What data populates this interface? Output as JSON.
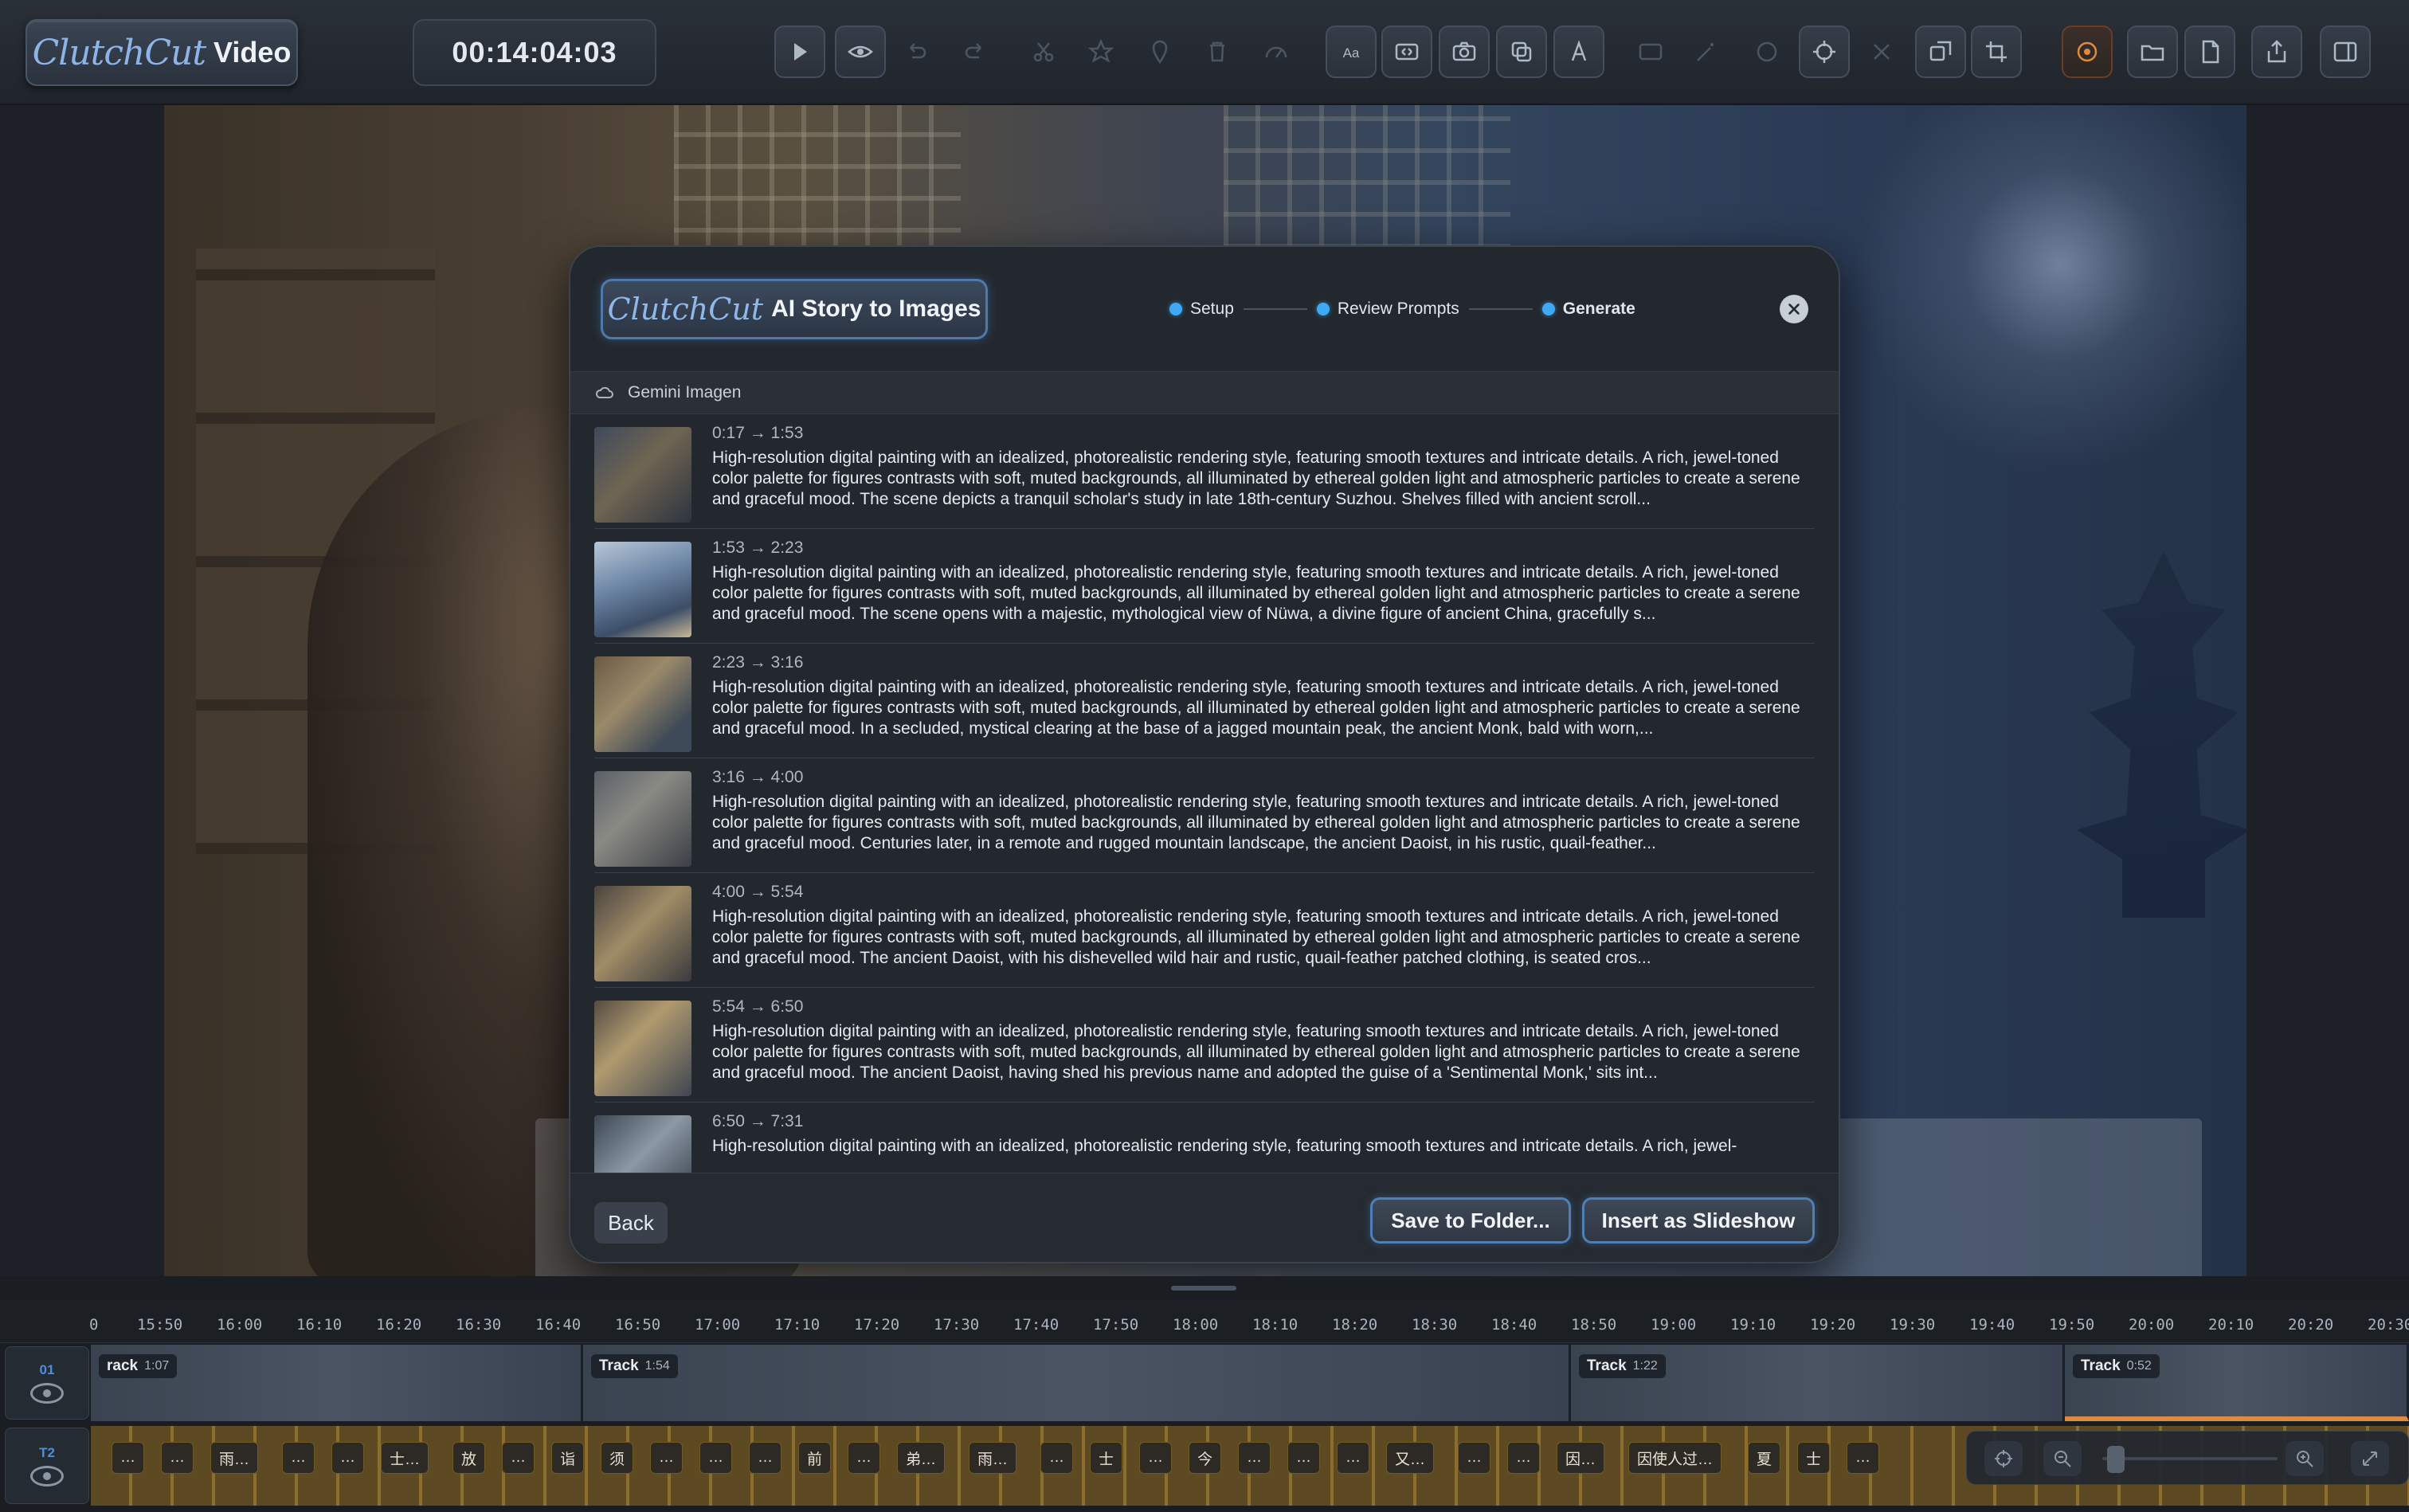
{
  "app": {
    "brand_script": "ClutchCut",
    "brand_word": "Video",
    "timecode": "00:14:04:03"
  },
  "toolbar": {
    "buttons": [
      {
        "name": "play-icon",
        "active": true
      },
      {
        "name": "eye-icon",
        "active": true
      },
      {
        "name": "undo-icon",
        "active": false
      },
      {
        "name": "redo-icon",
        "active": false
      },
      {
        "name": "cut-icon",
        "active": false
      },
      {
        "name": "star-icon",
        "active": false
      },
      {
        "name": "marker-icon",
        "active": false
      },
      {
        "name": "delete-icon",
        "active": false
      },
      {
        "name": "speed-icon",
        "active": false
      },
      {
        "name": "text-icon",
        "active": true
      },
      {
        "name": "transition-icon",
        "active": true
      },
      {
        "name": "camera-icon",
        "active": true
      },
      {
        "name": "layers-icon",
        "active": true
      },
      {
        "name": "font-icon",
        "active": true
      },
      {
        "name": "caption-icon",
        "active": false
      },
      {
        "name": "magic-icon",
        "active": false
      },
      {
        "name": "color-icon",
        "active": false
      },
      {
        "name": "target-icon",
        "active": true
      },
      {
        "name": "mute-icon",
        "active": false
      },
      {
        "name": "resize-icon",
        "active": true
      },
      {
        "name": "crop-icon",
        "active": true
      },
      {
        "name": "record-icon",
        "active": true
      },
      {
        "name": "folder-icon",
        "active": true
      },
      {
        "name": "document-icon",
        "active": true
      },
      {
        "name": "export-icon",
        "active": true
      },
      {
        "name": "sidebar-icon",
        "active": true
      }
    ]
  },
  "modal": {
    "logo_script": "ClutchCut",
    "logo_word": "AI Story to Images",
    "steps": [
      {
        "label": "Setup",
        "active": false
      },
      {
        "label": "Review Prompts",
        "active": false
      },
      {
        "label": "Generate",
        "active": true
      }
    ],
    "provider": "Gemini Imagen",
    "items": [
      {
        "time": "0:17 → 1:53",
        "desc": "High-resolution digital painting with an idealized, photorealistic rendering style, featuring smooth textures and intricate details. A rich, jewel-toned color palette for figures contrasts with soft, muted backgrounds, all illuminated by ethereal golden light and atmospheric particles to create a serene and graceful mood. The scene depicts a tranquil scholar's study in late 18th-century Suzhou. Shelves filled with ancient scroll..."
      },
      {
        "time": "1:53 → 2:23",
        "desc": "High-resolution digital painting with an idealized, photorealistic rendering style, featuring smooth textures and intricate details. A rich, jewel-toned color palette for figures contrasts with soft, muted backgrounds, all illuminated by ethereal golden light and atmospheric particles to create a serene and graceful mood. The scene opens with a majestic, mythological view of Nüwa, a divine figure of ancient China, gracefully s..."
      },
      {
        "time": "2:23 → 3:16",
        "desc": "High-resolution digital painting with an idealized, photorealistic rendering style, featuring smooth textures and intricate details. A rich, jewel-toned color palette for figures contrasts with soft, muted backgrounds, all illuminated by ethereal golden light and atmospheric particles to create a serene and graceful mood. In a secluded, mystical clearing at the base of a jagged mountain peak, the ancient Monk, bald with worn,..."
      },
      {
        "time": "3:16 → 4:00",
        "desc": "High-resolution digital painting with an idealized, photorealistic rendering style, featuring smooth textures and intricate details. A rich, jewel-toned color palette for figures contrasts with soft, muted backgrounds, all illuminated by ethereal golden light and atmospheric particles to create a serene and graceful mood. Centuries later, in a remote and rugged mountain landscape, the ancient Daoist, in his rustic, quail-feather..."
      },
      {
        "time": "4:00 → 5:54",
        "desc": "High-resolution digital painting with an idealized, photorealistic rendering style, featuring smooth textures and intricate details. A rich, jewel-toned color palette for figures contrasts with soft, muted backgrounds, all illuminated by ethereal golden light and atmospheric particles to create a serene and graceful mood. The ancient Daoist, with his dishevelled wild hair and rustic, quail-feather patched clothing, is seated cros..."
      },
      {
        "time": "5:54 → 6:50",
        "desc": "High-resolution digital painting with an idealized, photorealistic rendering style, featuring smooth textures and intricate details. A rich, jewel-toned color palette for figures contrasts with soft, muted backgrounds, all illuminated by ethereal golden light and atmospheric particles to create a serene and graceful mood. The ancient Daoist, having shed his previous name and adopted the guise of a 'Sentimental Monk,' sits int..."
      },
      {
        "time": "6:50 → 7:31",
        "desc": "High-resolution digital painting with an idealized, photorealistic rendering style, featuring smooth textures and intricate details. A rich, jewel-"
      }
    ],
    "back_label": "Back",
    "save_label": "Save to Folder...",
    "insert_label": "Insert as Slideshow"
  },
  "timeline": {
    "ruler": [
      "0",
      "15:50",
      "16:00",
      "16:10",
      "16:20",
      "16:30",
      "16:40",
      "16:50",
      "17:00",
      "17:10",
      "17:20",
      "17:30",
      "17:40",
      "17:50",
      "18:00",
      "18:10",
      "18:20",
      "18:30",
      "18:40",
      "18:50",
      "19:00",
      "19:10",
      "19:20",
      "19:30",
      "19:40",
      "19:50",
      "20:00",
      "20:10",
      "20:20",
      "20:30"
    ],
    "tracks": [
      {
        "num": "01"
      },
      {
        "num": "T2"
      }
    ],
    "clips": [
      {
        "label": "rack",
        "duration": "1:07"
      },
      {
        "label": "Track",
        "duration": "1:54"
      },
      {
        "label": "Track",
        "duration": "1:22"
      },
      {
        "label": "Track",
        "duration": "0:52"
      }
    ],
    "subtitles": [
      "…",
      "…",
      "雨…",
      "…",
      "…",
      "士…",
      "放",
      "…",
      "诣",
      "须",
      "…",
      "…",
      "…",
      "前",
      "…",
      "弟…",
      "雨…",
      "…",
      "士",
      "…",
      "今",
      "…",
      "…",
      "…",
      "又…",
      "…",
      "…",
      "因…",
      "因使人过…",
      "夏",
      "士",
      "…"
    ]
  }
}
